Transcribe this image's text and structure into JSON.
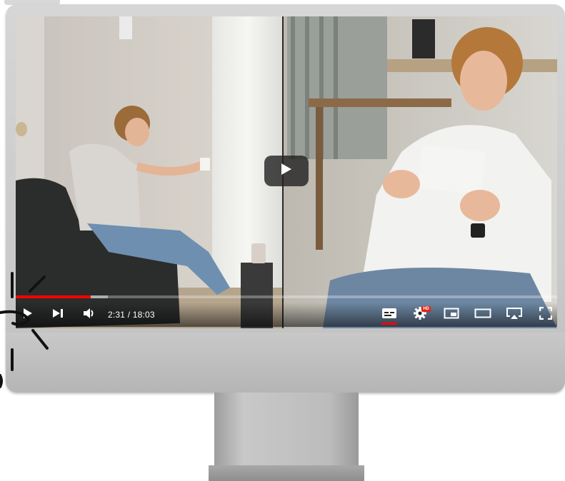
{
  "player": {
    "time_display": "2:31 / 18:03",
    "progress_fraction": 0.139,
    "buffered_fraction": 0.17,
    "quality_badge": "HD",
    "accent_color": "#ff0000"
  },
  "icons": {
    "big_play": "play-icon",
    "play": "play-icon",
    "next": "next-icon",
    "volume": "volume-icon",
    "subtitles": "subtitles-icon",
    "settings": "gear-icon",
    "miniplayer": "miniplayer-icon",
    "theater": "theater-mode-icon",
    "airplay": "airplay-icon",
    "fullscreen": "fullscreen-icon"
  }
}
